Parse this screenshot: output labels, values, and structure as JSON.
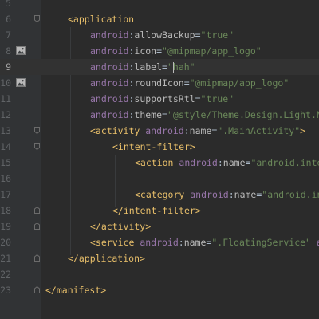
{
  "editor": {
    "lines": [
      {
        "num": "5",
        "parts": []
      },
      {
        "num": "6",
        "parts": [
          {
            "t": "tg",
            "v": "<application"
          }
        ]
      },
      {
        "num": "7",
        "parts": [
          {
            "t": "ns",
            "v": "android"
          },
          {
            "t": "tx",
            "v": ":"
          },
          {
            "t": "at",
            "v": "allowBackup"
          },
          {
            "t": "tx",
            "v": "="
          },
          {
            "t": "vl",
            "v": "\"true\""
          }
        ]
      },
      {
        "num": "8",
        "icon": "image-icon",
        "parts": [
          {
            "t": "ns",
            "v": "android"
          },
          {
            "t": "tx",
            "v": ":"
          },
          {
            "t": "at",
            "v": "icon"
          },
          {
            "t": "tx",
            "v": "="
          },
          {
            "t": "vl",
            "v": "\"@mipmap/app_logo\""
          }
        ]
      },
      {
        "num": "9",
        "current": true,
        "parts": [
          {
            "t": "ns",
            "v": "android"
          },
          {
            "t": "tx",
            "v": ":"
          },
          {
            "t": "at",
            "v": "label"
          },
          {
            "t": "tx",
            "v": "="
          },
          {
            "t": "vl",
            "v": "\""
          },
          {
            "t": "caret"
          },
          {
            "t": "vl",
            "v": "hah\""
          }
        ]
      },
      {
        "num": "10",
        "icon": "image-icon",
        "parts": [
          {
            "t": "ns",
            "v": "android"
          },
          {
            "t": "tx",
            "v": ":"
          },
          {
            "t": "at",
            "v": "roundIcon"
          },
          {
            "t": "tx",
            "v": "="
          },
          {
            "t": "vl",
            "v": "\"@mipmap/app_logo\""
          }
        ]
      },
      {
        "num": "11",
        "parts": [
          {
            "t": "ns",
            "v": "android"
          },
          {
            "t": "tx",
            "v": ":"
          },
          {
            "t": "at",
            "v": "supportsRtl"
          },
          {
            "t": "tx",
            "v": "="
          },
          {
            "t": "vl",
            "v": "\"true\""
          }
        ]
      },
      {
        "num": "12",
        "parts": [
          {
            "t": "ns",
            "v": "android"
          },
          {
            "t": "tx",
            "v": ":"
          },
          {
            "t": "at",
            "v": "theme"
          },
          {
            "t": "tx",
            "v": "="
          },
          {
            "t": "vl",
            "v": "\"@style/Theme.Design.Light.N"
          }
        ]
      },
      {
        "num": "13",
        "parts": [
          {
            "t": "tg",
            "v": "<activity "
          },
          {
            "t": "ns",
            "v": "android"
          },
          {
            "t": "tx",
            "v": ":"
          },
          {
            "t": "at",
            "v": "name"
          },
          {
            "t": "tx",
            "v": "="
          },
          {
            "t": "vl",
            "v": "\".MainActivity\""
          },
          {
            "t": "tg",
            "v": ">"
          }
        ]
      },
      {
        "num": "14",
        "parts": [
          {
            "t": "tg",
            "v": "<intent-filter>"
          }
        ]
      },
      {
        "num": "15",
        "parts": [
          {
            "t": "tg",
            "v": "<action "
          },
          {
            "t": "ns",
            "v": "android"
          },
          {
            "t": "tx",
            "v": ":"
          },
          {
            "t": "at",
            "v": "name"
          },
          {
            "t": "tx",
            "v": "="
          },
          {
            "t": "vl",
            "v": "\"android.inte"
          }
        ]
      },
      {
        "num": "16",
        "parts": []
      },
      {
        "num": "17",
        "parts": [
          {
            "t": "tg",
            "v": "<category "
          },
          {
            "t": "ns",
            "v": "android"
          },
          {
            "t": "tx",
            "v": ":"
          },
          {
            "t": "at",
            "v": "name"
          },
          {
            "t": "tx",
            "v": "="
          },
          {
            "t": "vl",
            "v": "\"android.in"
          }
        ]
      },
      {
        "num": "18",
        "parts": [
          {
            "t": "tg",
            "v": "</intent-filter>"
          }
        ]
      },
      {
        "num": "19",
        "parts": [
          {
            "t": "tg",
            "v": "</activity>"
          }
        ]
      },
      {
        "num": "20",
        "parts": [
          {
            "t": "tg",
            "v": "<service "
          },
          {
            "t": "ns",
            "v": "android"
          },
          {
            "t": "tx",
            "v": ":"
          },
          {
            "t": "at",
            "v": "name"
          },
          {
            "t": "tx",
            "v": "="
          },
          {
            "t": "vl",
            "v": "\".FloatingService\" "
          },
          {
            "t": "ns",
            "v": "a"
          }
        ]
      },
      {
        "num": "21",
        "parts": [
          {
            "t": "tg",
            "v": "</application>"
          }
        ]
      },
      {
        "num": "22",
        "parts": []
      },
      {
        "num": "23",
        "parts": [
          {
            "t": "tg",
            "v": "</manifest>"
          }
        ]
      }
    ]
  },
  "colors": {
    "background": "#2b2b2b",
    "gutter": "#313335",
    "current_line": "#323232",
    "tag": "#e8bf6a",
    "namespace": "#9876aa",
    "attribute": "#bababa",
    "value": "#6a8759",
    "line_number": "#606366"
  }
}
